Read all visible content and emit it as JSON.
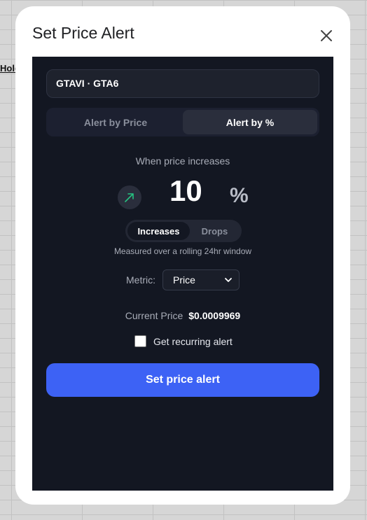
{
  "background": {
    "cell_label": "Hold"
  },
  "modal": {
    "title": "Set Price Alert",
    "close_icon": "close-icon"
  },
  "alert": {
    "ticker": "GTAVI · GTA6",
    "mode_tabs": [
      {
        "label": "Alert by Price",
        "active": false
      },
      {
        "label": "Alert by %",
        "active": true
      }
    ],
    "caption": "When price increases",
    "trend_icon": "trend-up-arrow-icon",
    "value": "10",
    "unit": "%",
    "direction": [
      {
        "label": "Increases",
        "active": true
      },
      {
        "label": "Drops",
        "active": false
      }
    ],
    "hint": "Measured over a rolling 24hr window",
    "metric_label": "Metric:",
    "metric_selected": "Price",
    "current_price_label": "Current Price",
    "current_price_value": "$0.0009969",
    "recurring_label": "Get recurring alert",
    "recurring_checked": false,
    "submit_label": "Set price alert"
  },
  "colors": {
    "panel_bg": "#131722",
    "accent": "#3d62f5",
    "trend_up": "#26c281"
  }
}
